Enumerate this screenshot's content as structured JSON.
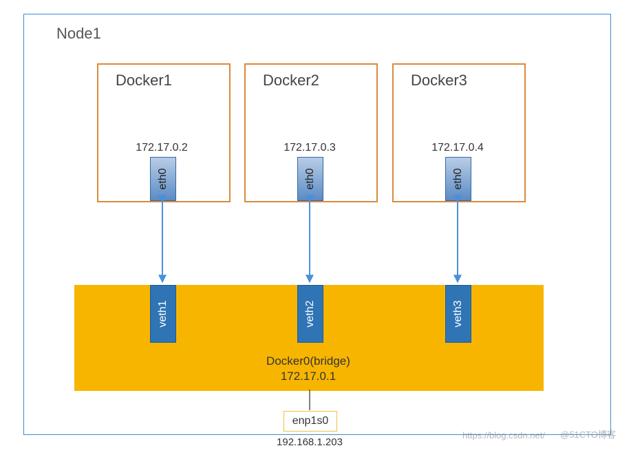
{
  "node": {
    "title": "Node1"
  },
  "containers": [
    {
      "name": "Docker1",
      "ip": "172.17.0.2",
      "iface": "eth0",
      "veth": "veth1"
    },
    {
      "name": "Docker2",
      "ip": "172.17.0.3",
      "iface": "eth0",
      "veth": "veth2"
    },
    {
      "name": "Docker3",
      "ip": "172.17.0.4",
      "iface": "eth0",
      "veth": "veth3"
    }
  ],
  "bridge": {
    "name": "Docker0(bridge)",
    "ip": "172.17.0.1"
  },
  "host_interface": {
    "name": "enp1s0",
    "ip": "192.168.1.203"
  },
  "watermark": {
    "blog": "https://blog.csdn.net/",
    "tag": "@51CTO博客"
  }
}
